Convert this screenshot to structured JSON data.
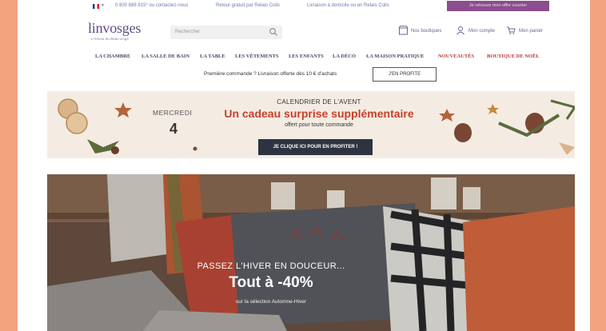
{
  "topbar": {
    "phone": "0 800 888 815* ou contactez-nous",
    "returns": "Retour gratuit par Relais Colis",
    "delivery": "Livraison à domicile ou en Relais Colis",
    "promo": "Je retrouve mon offre courrier"
  },
  "header": {
    "logo": "linvosges",
    "logo_sub": "L'Amour du Beau Linge",
    "search_placeholder": "Rechercher",
    "stores": "Nos boutiques",
    "account": "Mon compte",
    "cart": "Mon panier"
  },
  "nav": {
    "items": [
      "LA CHAMBRE",
      "LA SALLE DE BAIN",
      "LA TABLE",
      "LES VÊTEMENTS",
      "LES ENFANTS",
      "LA DÉCO",
      "LA MAISON PRATIQUE",
      "NOUVEAUTÉS",
      "BOUTIQUE DE NOËL"
    ]
  },
  "promo_bar": {
    "text": "Première commande ? Livraison offerte dès 10 € d'achats",
    "button": "J'EN PROFITE"
  },
  "advent": {
    "day": "MERCREDI",
    "num": "4",
    "title": "CALENDRIER DE L'AVENT",
    "headline": "Un cadeau surprise supplémentaire",
    "sub": "offert pour toute commande",
    "cta": "JE CLIQUE ICI POUR EN PROFITER !"
  },
  "hero": {
    "line1": "PASSEZ L'HIVER EN DOUCEUR...",
    "line2": "Tout à -40%",
    "line3": "sur la sélection Automne-Hiver"
  },
  "colors": {
    "brand": "#5f4a86",
    "accent_red": "#c83f2b",
    "nav_highlight": "#b43a3a",
    "promo_purple": "#8b4d8d",
    "frame": "#f4a37f"
  }
}
